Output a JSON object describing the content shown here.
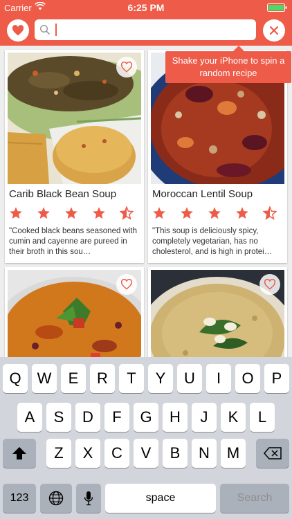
{
  "status_bar": {
    "carrier": "Carrier",
    "time": "6:25 PM"
  },
  "header": {
    "favorites_icon": "heart-icon",
    "search_value": "",
    "clear_icon": "close-icon",
    "colors": {
      "accent": "#ee5b49"
    }
  },
  "tooltip": {
    "text": "Shake your iPhone to spin a random recipe"
  },
  "recipes": [
    {
      "title": "Carib Black Bean Soup",
      "rating": 4.5,
      "description": "\"Cooked black beans seasoned with cumin and cayenne are pureed in their broth in this sou…"
    },
    {
      "title": "Moroccan Lentil Soup",
      "rating": 4.5,
      "description": "\"This soup is deliciously spicy, completely vegetarian, has no cholesterol, and is high in protei…"
    },
    {
      "title": "",
      "rating": 0,
      "description": ""
    },
    {
      "title": "",
      "rating": 0,
      "description": ""
    }
  ],
  "keyboard": {
    "row1": [
      "Q",
      "W",
      "E",
      "R",
      "T",
      "Y",
      "U",
      "I",
      "O",
      "P"
    ],
    "row2": [
      "A",
      "S",
      "D",
      "F",
      "G",
      "H",
      "J",
      "K",
      "L"
    ],
    "row3": [
      "Z",
      "X",
      "C",
      "V",
      "B",
      "N",
      "M"
    ],
    "numbers_key": "123",
    "space_key": "space",
    "search_key": "Search"
  }
}
